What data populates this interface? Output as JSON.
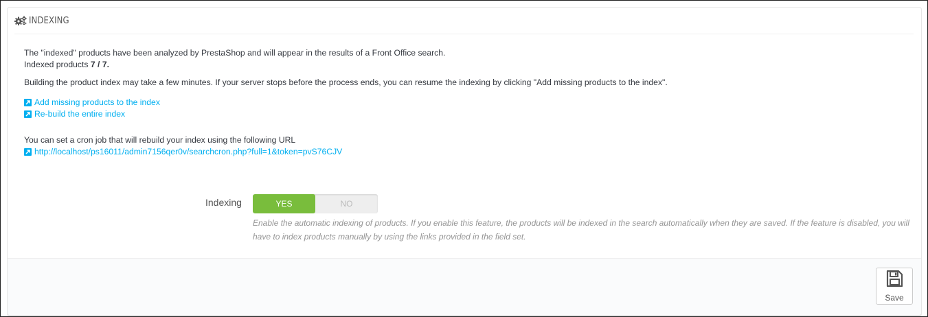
{
  "panel": {
    "title": "Indexing",
    "title_icon": "cogs-icon"
  },
  "body": {
    "intro_line": "The \"indexed\" products have been analyzed by PrestaShop and will appear in the results of a Front Office search.",
    "indexed_label": "Indexed products ",
    "indexed_count": "7 / 7",
    "indexed_suffix": ".",
    "build_note": "Building the product index may take a few minutes. If your server stops before the process ends, you can resume the indexing by clicking \"Add missing products to the index\".",
    "links": {
      "add_missing": "Add missing products to the index",
      "rebuild": "Re-build the entire index"
    },
    "cron_text": "You can set a cron job that will rebuild your index using the following URL",
    "cron_url": "http://localhost/ps16011/admin7156qer0v/searchcron.php?full=1&token=pvS76CJV"
  },
  "form": {
    "indexing_label": "Indexing",
    "switch": {
      "yes_label": "YES",
      "no_label": "NO",
      "selected": "YES"
    },
    "help_text": "Enable the automatic indexing of products. If you enable this feature, the products will be indexed in the search automatically when they are saved. If the feature is disabled, you will have to index products manually by using the links provided in the field set."
  },
  "footer": {
    "save_label": "Save"
  },
  "colors": {
    "link": "#00aff0",
    "switch_on": "#79bd3c",
    "text": "#363a41",
    "help": "#959595"
  }
}
